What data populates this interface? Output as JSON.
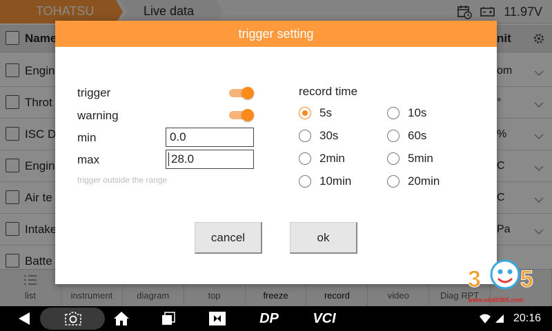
{
  "header": {
    "breadcrumb_1": "TOHATSU",
    "breadcrumb_2": "Live data",
    "battery_voltage": "11.97V"
  },
  "table": {
    "header_name": "Name",
    "header_unit": "nit",
    "rows": [
      {
        "name": "Engin",
        "unit": "om"
      },
      {
        "name": "Throt",
        "unit": "°"
      },
      {
        "name": "ISC D",
        "unit": "%"
      },
      {
        "name": "Engin",
        "unit": "C"
      },
      {
        "name": "Air te",
        "unit": "C"
      },
      {
        "name": "Intake",
        "unit": "Pa"
      },
      {
        "name": "Batte",
        "unit": ""
      }
    ]
  },
  "bottom_tabs": [
    "list",
    "instrument",
    "diagram",
    "top",
    "freeze",
    "record",
    "video",
    "Diag RPT"
  ],
  "dialog": {
    "title": "trigger setting",
    "trigger_label": "trigger",
    "trigger_on": true,
    "warning_label": "warning",
    "warning_on": true,
    "min_label": "min",
    "min_value": "0.0",
    "max_label": "max",
    "max_value": "28.0",
    "hint": "trigger outside the range",
    "record_time_label": "record time",
    "record_options": [
      "5s",
      "10s",
      "30s",
      "60s",
      "2min",
      "5min",
      "10min",
      "20min"
    ],
    "record_selected": "5s",
    "cancel_label": "cancel",
    "ok_label": "ok"
  },
  "navbar": {
    "time": "20:16",
    "dp_label": "DP",
    "vci_label": "VCI"
  },
  "watermark": {
    "text": "365",
    "url": "www.obdii365.com"
  },
  "colors": {
    "accent": "#ff9a3c",
    "toggle_on": "#ff8a1c"
  }
}
